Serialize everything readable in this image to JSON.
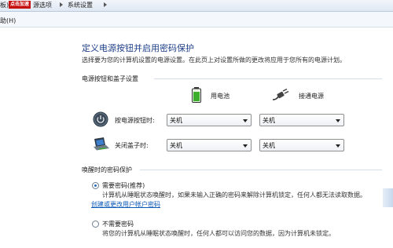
{
  "breadcrumb": {
    "items": [
      "板)",
      "源选项",
      "系统设置"
    ],
    "tag": "点击加速",
    "colors": {
      "tag_bg": "#c71010"
    }
  },
  "menu": {
    "help": "助(H)"
  },
  "page": {
    "title": "定义电源按钮并启用密码保护",
    "description": "选择要为您的计算机设置的电源设置。在此页上对设置所做的更改将应用于您所有的电源计划。"
  },
  "power_section": {
    "title": "电源按钮和盖子设置",
    "columns": [
      {
        "label": "用电池",
        "icon": "battery-icon"
      },
      {
        "label": "接通电源",
        "icon": "plug-icon"
      }
    ],
    "rows": [
      {
        "label": "按电源按钮时:",
        "icon": "power-button-icon",
        "battery": "关机",
        "plugged": "关机"
      },
      {
        "label": "关闭盖子时:",
        "icon": "laptop-lid-icon",
        "battery": "关机",
        "plugged": "关机"
      }
    ]
  },
  "password_section": {
    "title": "唤醒时的密码保护",
    "options": [
      {
        "label": "需要密码(推荐)",
        "checked": true,
        "description": "计算机从睡眠状态唤醒时，如果未输入正确的密码来解除计算机锁定，任何人都无法读取数据。",
        "link": "创建或更改用户帐户密码"
      },
      {
        "label": "不需要密码",
        "checked": false,
        "description": "将您的计算机从睡眠状态唤醒时，任何人都可以访问您的数据，因为计算机未锁定。"
      }
    ]
  }
}
